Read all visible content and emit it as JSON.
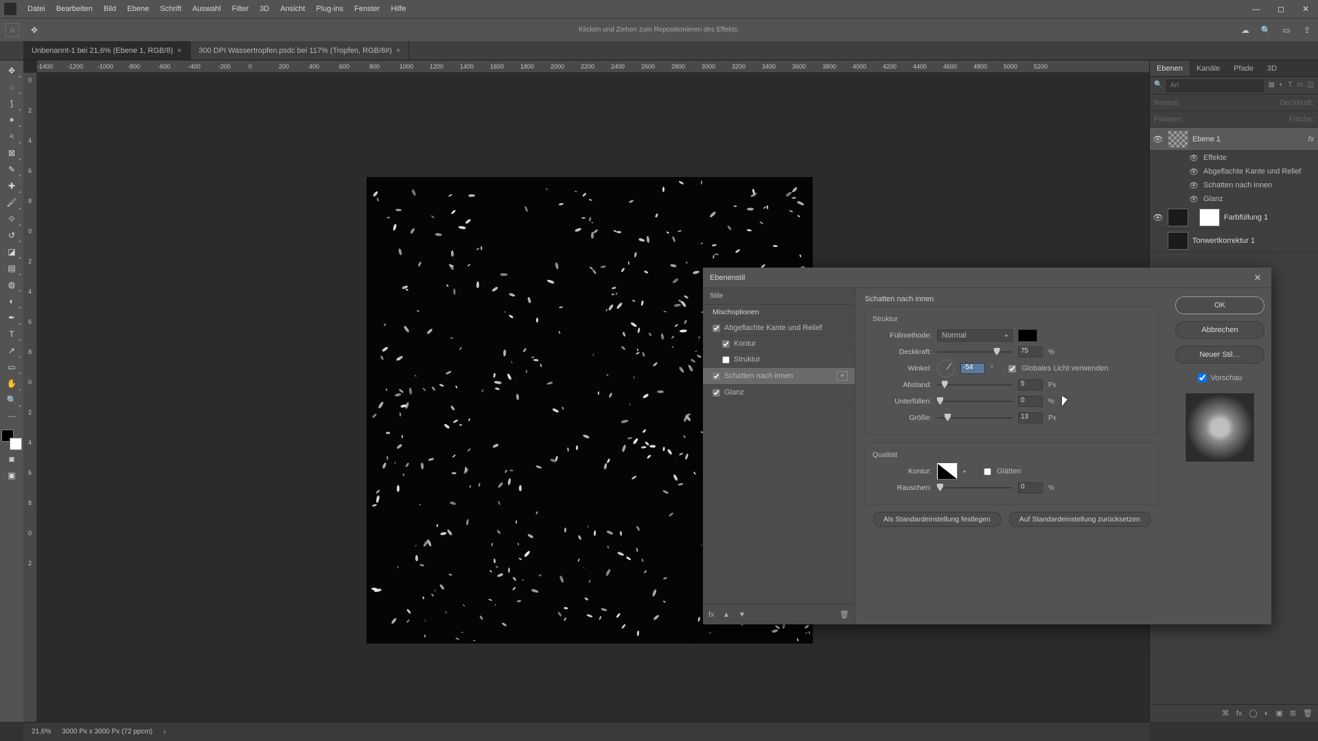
{
  "menu": {
    "items": [
      "Datei",
      "Bearbeiten",
      "Bild",
      "Ebene",
      "Schrift",
      "Auswahl",
      "Filter",
      "3D",
      "Ansicht",
      "Plug-ins",
      "Fenster",
      "Hilfe"
    ]
  },
  "optbar": {
    "hint": "Klicken und Ziehen zum Repositionieren des Effekts."
  },
  "tabs": [
    {
      "label": "Unbenannt-1 bei 21,6% (Ebene 1, RGB/8)",
      "active": true
    },
    {
      "label": "300 DPI Wassertropfen.psdc bei 117% (Tropfen, RGB/8#)",
      "active": false
    }
  ],
  "ruler_h": [
    "-1400",
    "-1200",
    "-1000",
    "-800",
    "-600",
    "-400",
    "-200",
    "0",
    "200",
    "400",
    "600",
    "800",
    "1000",
    "1200",
    "1400",
    "1600",
    "1800",
    "2000",
    "2200",
    "2400",
    "2600",
    "2800",
    "3000",
    "3200",
    "3400",
    "3600",
    "3800",
    "4000",
    "4200",
    "4400",
    "4600",
    "4800",
    "5000",
    "5200"
  ],
  "ruler_v": [
    "0",
    "2",
    "4",
    "6",
    "8",
    "0",
    "2",
    "4",
    "6",
    "8",
    "0",
    "2",
    "4",
    "6",
    "8",
    "0",
    "2"
  ],
  "panel": {
    "tabs": [
      "Ebenen",
      "Kanäle",
      "Pfade",
      "3D"
    ],
    "search_ph": "Art",
    "mode": "Normal",
    "deckkraft_lbl": "Deckkraft:",
    "fixieren_lbl": "Fixieren:",
    "flaeche_lbl": "Fläche:",
    "layers": {
      "l1": "Ebene 1",
      "eff": "Effekte",
      "fx1": "Abgeflachte Kante und Relief",
      "fx2": "Schatten nach innen",
      "fx3": "Glanz",
      "l2": "Farbfüllung 1",
      "l3": "Tonwertkorrektur 1"
    }
  },
  "status": {
    "zoom": "21,6%",
    "info": "3000 Px x 3000 Px (72 ppcm)"
  },
  "dialog": {
    "title": "Ebenenstil",
    "left": {
      "stile": "Stile",
      "misch": "Mischoptionen",
      "bevel": "Abgeflachte Kante und Relief",
      "kontur": "Kontur",
      "struktur": "Struktur",
      "inner": "Schatten nach innen",
      "glanz": "Glanz"
    },
    "mid": {
      "section": "Schatten nach innen",
      "struct": "Struktur",
      "fillmeth": "Füllmethode:",
      "fillmeth_val": "Normal",
      "deck": "Deckkraft:",
      "deck_val": "75",
      "winkel": "Winkel:",
      "winkel_val": "-54",
      "global": "Globales Licht verwenden",
      "abstand": "Abstand:",
      "abstand_val": "5",
      "unterf": "Unterfüllen:",
      "unterf_val": "0",
      "groesse": "Größe:",
      "groesse_val": "13",
      "qual": "Qualität",
      "kontur": "Kontur:",
      "glaetten": "Glätten",
      "rauschen": "Rauschen:",
      "rauschen_val": "0",
      "btn_make": "Als Standardeinstellung festlegen",
      "btn_reset": "Auf Standardeinstellung zurücksetzen",
      "px": "Px",
      "pct": "%",
      "deg": "°"
    },
    "right": {
      "ok": "OK",
      "cancel": "Abbrechen",
      "newstyle": "Neuer Stil…",
      "preview": "Vorschau"
    }
  }
}
